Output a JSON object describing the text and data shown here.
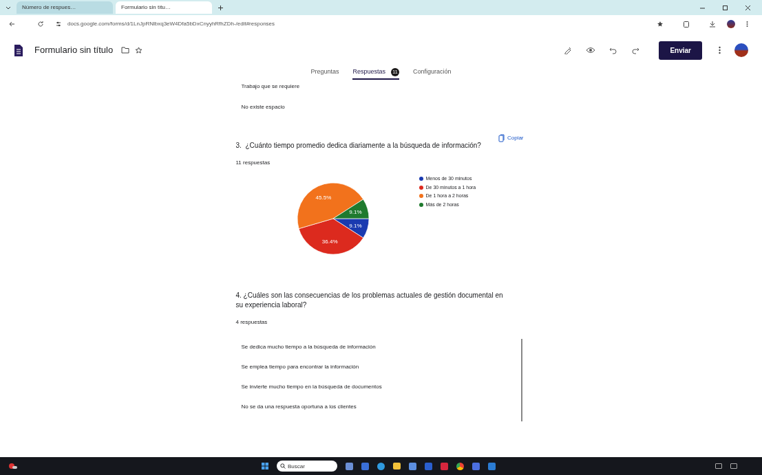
{
  "browser": {
    "tabs": [
      {
        "title": "Número de respues…",
        "selected": false
      },
      {
        "title": "Formulario sin títu…",
        "selected": true
      }
    ],
    "url": "docs.google.com/forms/d/1LnJpRNlbxq3eW4Dfa5bDxCnyyhRfhZDh-/edit#responses"
  },
  "form_header": {
    "title": "Formulario sin título",
    "send_button": "Enviar"
  },
  "form_tabs": [
    {
      "label": "Preguntas",
      "selected": false
    },
    {
      "label": "Respuestas",
      "badge": "11",
      "selected": true
    },
    {
      "label": "Configuración",
      "selected": false
    }
  ],
  "previous_answers": [
    "Trabajo que se requiere",
    "No existe espacio"
  ],
  "question_3": {
    "number": "3.",
    "text": "¿Cuánto tiempo promedio dedica diariamente a la búsqueda de información?",
    "copy_label": "Copiar",
    "count": "11 respuestas",
    "chart_data": {
      "type": "pie",
      "categories": [
        "Menos de 30 minutos",
        "De 30 minutos a 1 hora",
        "De 1 hora a 2 horas",
        "Más de 2 horas"
      ],
      "values": [
        9.1,
        36.4,
        45.5,
        9.1
      ],
      "legend": "right",
      "colors": [
        "#1a3ab0",
        "#dc2a1e",
        "#f2721c",
        "#1f7a2e"
      ],
      "data_labels": true,
      "value_labels": [
        "9.1%",
        "36.4%",
        "45.5%",
        "9.1%"
      ]
    }
  },
  "question_4": {
    "text": "4. ¿Cuáles son las consecuencias de los problemas actuales de gestión documental en su experiencia laboral?",
    "count": "4 respuestas",
    "answers": [
      "Se dedica mucho tiempo a la búsqueda de información",
      "Se emplea tiempo para encontrar la información",
      "Se invierte mucho tiempo en la búsqueda de documentos",
      "No se da una respuesta oportuna a los clientes"
    ]
  },
  "taskbar": {
    "search_placeholder": "Buscar"
  }
}
